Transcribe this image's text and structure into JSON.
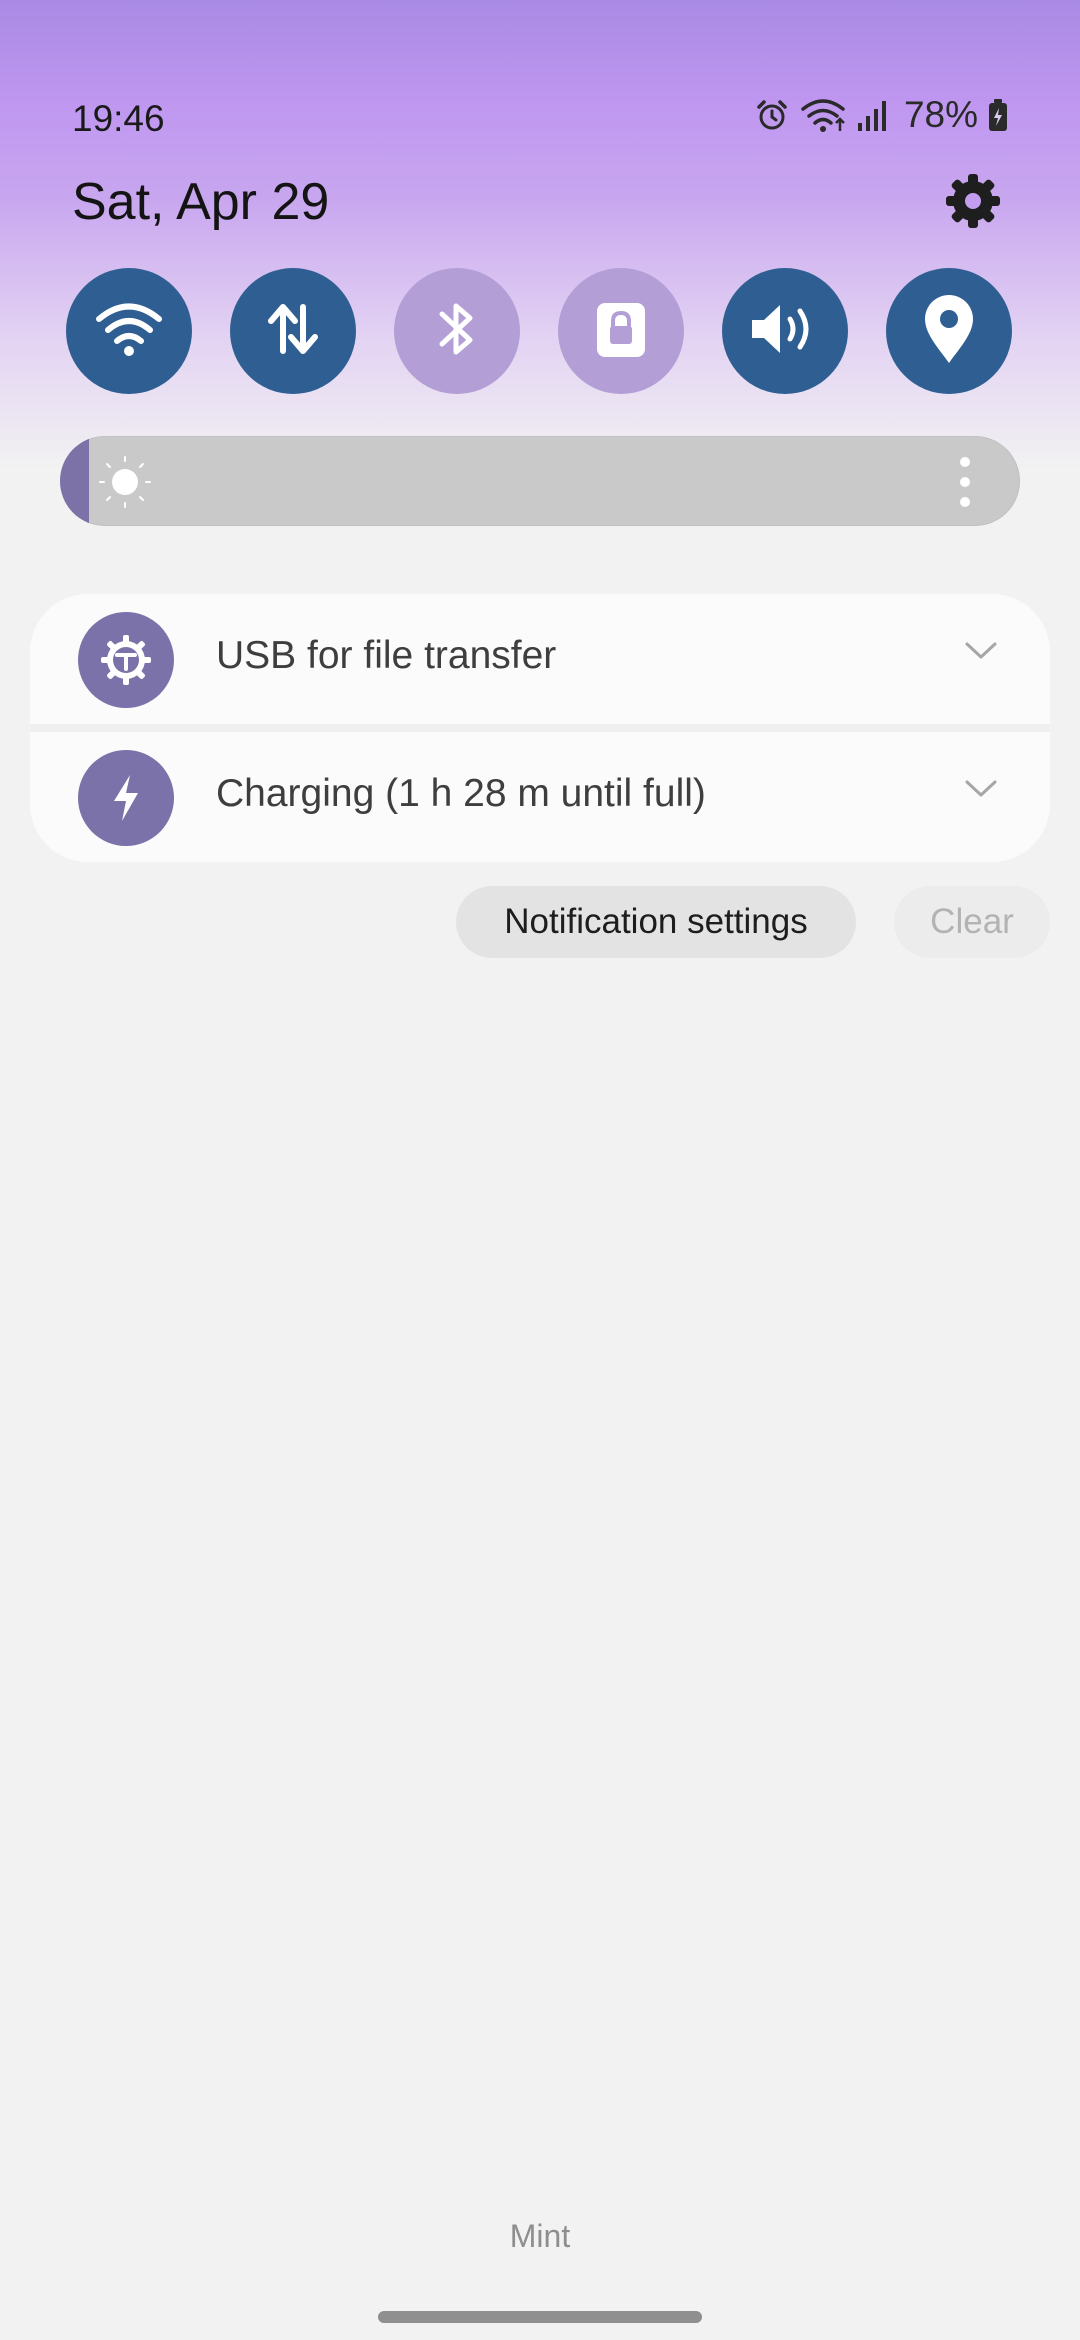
{
  "status_bar": {
    "time": "19:46",
    "battery_percent": "78%",
    "icons": [
      "alarm-icon",
      "wifi-icon",
      "signal-icon",
      "battery-charging-icon"
    ]
  },
  "header": {
    "date": "Sat, Apr 29",
    "settings_icon": "gear-icon"
  },
  "quick_toggles": [
    {
      "name": "wifi",
      "icon": "wifi-icon",
      "state": "on"
    },
    {
      "name": "mobile-data",
      "icon": "data-arrows-icon",
      "state": "on"
    },
    {
      "name": "bluetooth",
      "icon": "bluetooth-icon",
      "state": "off"
    },
    {
      "name": "secure-folder",
      "icon": "lock-icon",
      "state": "off"
    },
    {
      "name": "sound",
      "icon": "speaker-icon",
      "state": "on"
    },
    {
      "name": "location",
      "icon": "location-pin-icon",
      "state": "on"
    }
  ],
  "brightness": {
    "level_fraction": 0.03,
    "icon": "sun-icon"
  },
  "notifications": [
    {
      "icon": "usb-settings-icon",
      "text": "USB for file transfer"
    },
    {
      "icon": "charging-bolt-icon",
      "text": "Charging (1 h 28 m until full)"
    }
  ],
  "actions": {
    "notification_settings": "Notification settings",
    "clear": "Clear"
  },
  "carrier": "Mint",
  "colors": {
    "toggle_on": "#2f5f92",
    "toggle_off": "#b39fd6",
    "accent": "#7b72a9"
  }
}
